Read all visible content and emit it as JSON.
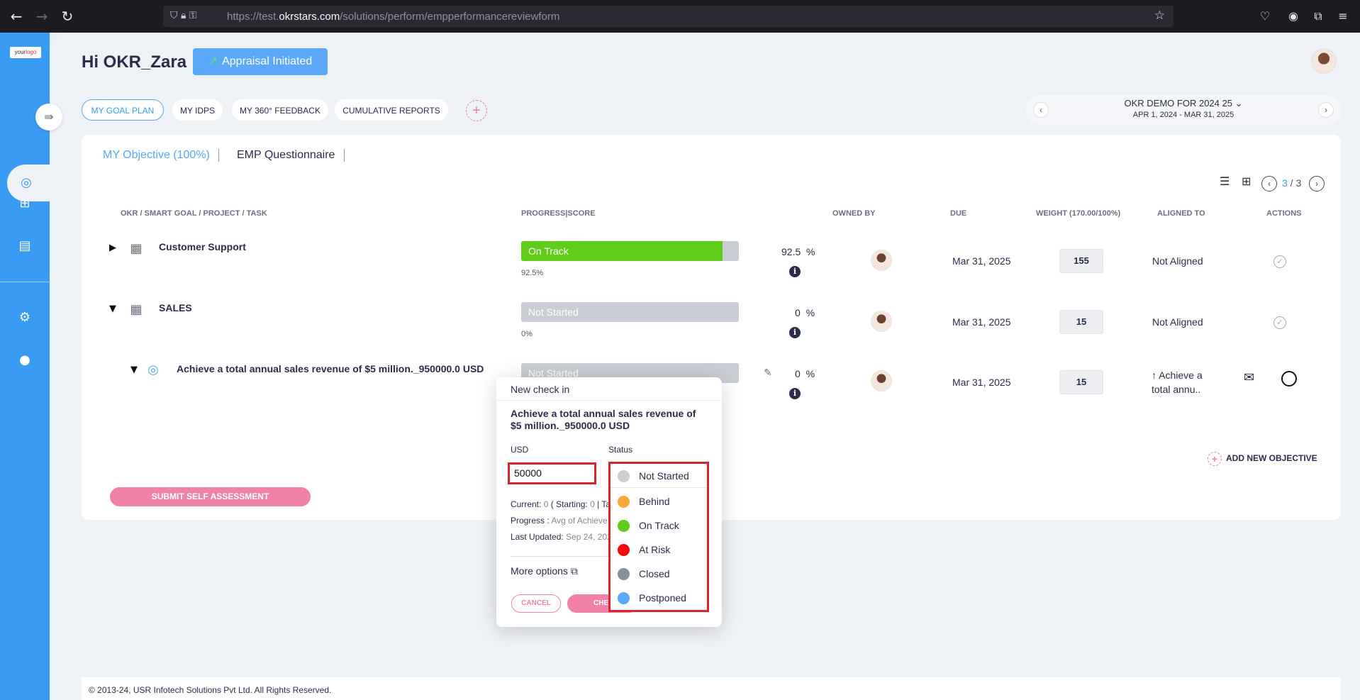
{
  "browser": {
    "url_prefix": "https://test.",
    "url_domain": "okrstars.com",
    "url_path": "/solutions/perform/empperformancereviewform"
  },
  "sidebar": {
    "logo_text": "your",
    "logo_accent": "logo"
  },
  "header": {
    "greeting": "Hi OKR_Zara",
    "appraisal_label": "Appraisal Initiated"
  },
  "tabs": [
    "MY GOAL PLAN",
    "MY IDPS",
    "MY 360° FEEDBACK",
    "CUMULATIVE REPORTS"
  ],
  "period": {
    "title": "OKR DEMO FOR 2024 25",
    "dates": "APR 1, 2024 - MAR 31, 2025"
  },
  "card_tabs": {
    "objective": "MY Objective (100%)",
    "questionnaire": "EMP Questionnaire"
  },
  "pager": {
    "current": "3",
    "sep": " / ",
    "total": "3"
  },
  "columns": {
    "goal": "OKR / SMART GOAL / PROJECT / TASK",
    "progress": "PROGRESS|SCORE",
    "owned_by": "OWNED BY",
    "due": "DUE",
    "weight": "WEIGHT (170.00/100%)",
    "aligned_to": "ALIGNED TO",
    "actions": "ACTIONS"
  },
  "rows": [
    {
      "title": "Customer Support",
      "status": "On Track",
      "progress": 0.925,
      "pct_label": "92.5%",
      "score": "92.5",
      "pct_sign": "%",
      "due": "Mar 31, 2025",
      "weight": "155",
      "aligned": "Not Aligned"
    },
    {
      "title": "SALES",
      "status": "Not Started",
      "progress": 0,
      "pct_label": "0%",
      "score": "0",
      "pct_sign": "%",
      "due": "Mar 31, 2025",
      "weight": "15",
      "aligned": "Not Aligned"
    },
    {
      "title": "Achieve a total annual sales revenue of $5 million._950000.0 USD",
      "status": "Not Started",
      "progress": 0,
      "score": "0",
      "pct_sign": "%",
      "due": "Mar 31, 2025",
      "weight": "15",
      "aligned_line1": "↑ Achieve a",
      "aligned_line2": "total annu.."
    }
  ],
  "add_objective": "ADD NEW OBJECTIVE",
  "submit_label": "SUBMIT SELF ASSESSMENT",
  "footer": "© 2013-24, USR Infotech Solutions Pvt Ltd. All Rights Reserved.",
  "popup": {
    "title": "New check in",
    "goal": "Achieve a total annual sales revenue of $5 million._950000.0 USD",
    "unit_label": "USD",
    "status_label": "Status",
    "value": "50000",
    "current_label": "Current:",
    "current_value": "0",
    "starting_label": "( Starting:",
    "starting_value": "0",
    "target_label": "| Ta",
    "progress_label": "Progress :",
    "progress_value": "Avg of Achieve",
    "updated_label": "Last Updated:",
    "updated_value": "Sep 24, 202",
    "more_options": "More options",
    "cancel": "CANCEL",
    "checkin": "CHECK IN"
  },
  "status_options": [
    {
      "label": "Not Started",
      "color": "#c9cdd4"
    },
    {
      "label": "Behind",
      "color": "#f9a83b"
    },
    {
      "label": "On Track",
      "color": "#5ecc18"
    },
    {
      "label": "At Risk",
      "color": "#f50a0a"
    },
    {
      "label": "Closed",
      "color": "#8a9097"
    },
    {
      "label": "Postponed",
      "color": "#5aa8f7"
    }
  ]
}
